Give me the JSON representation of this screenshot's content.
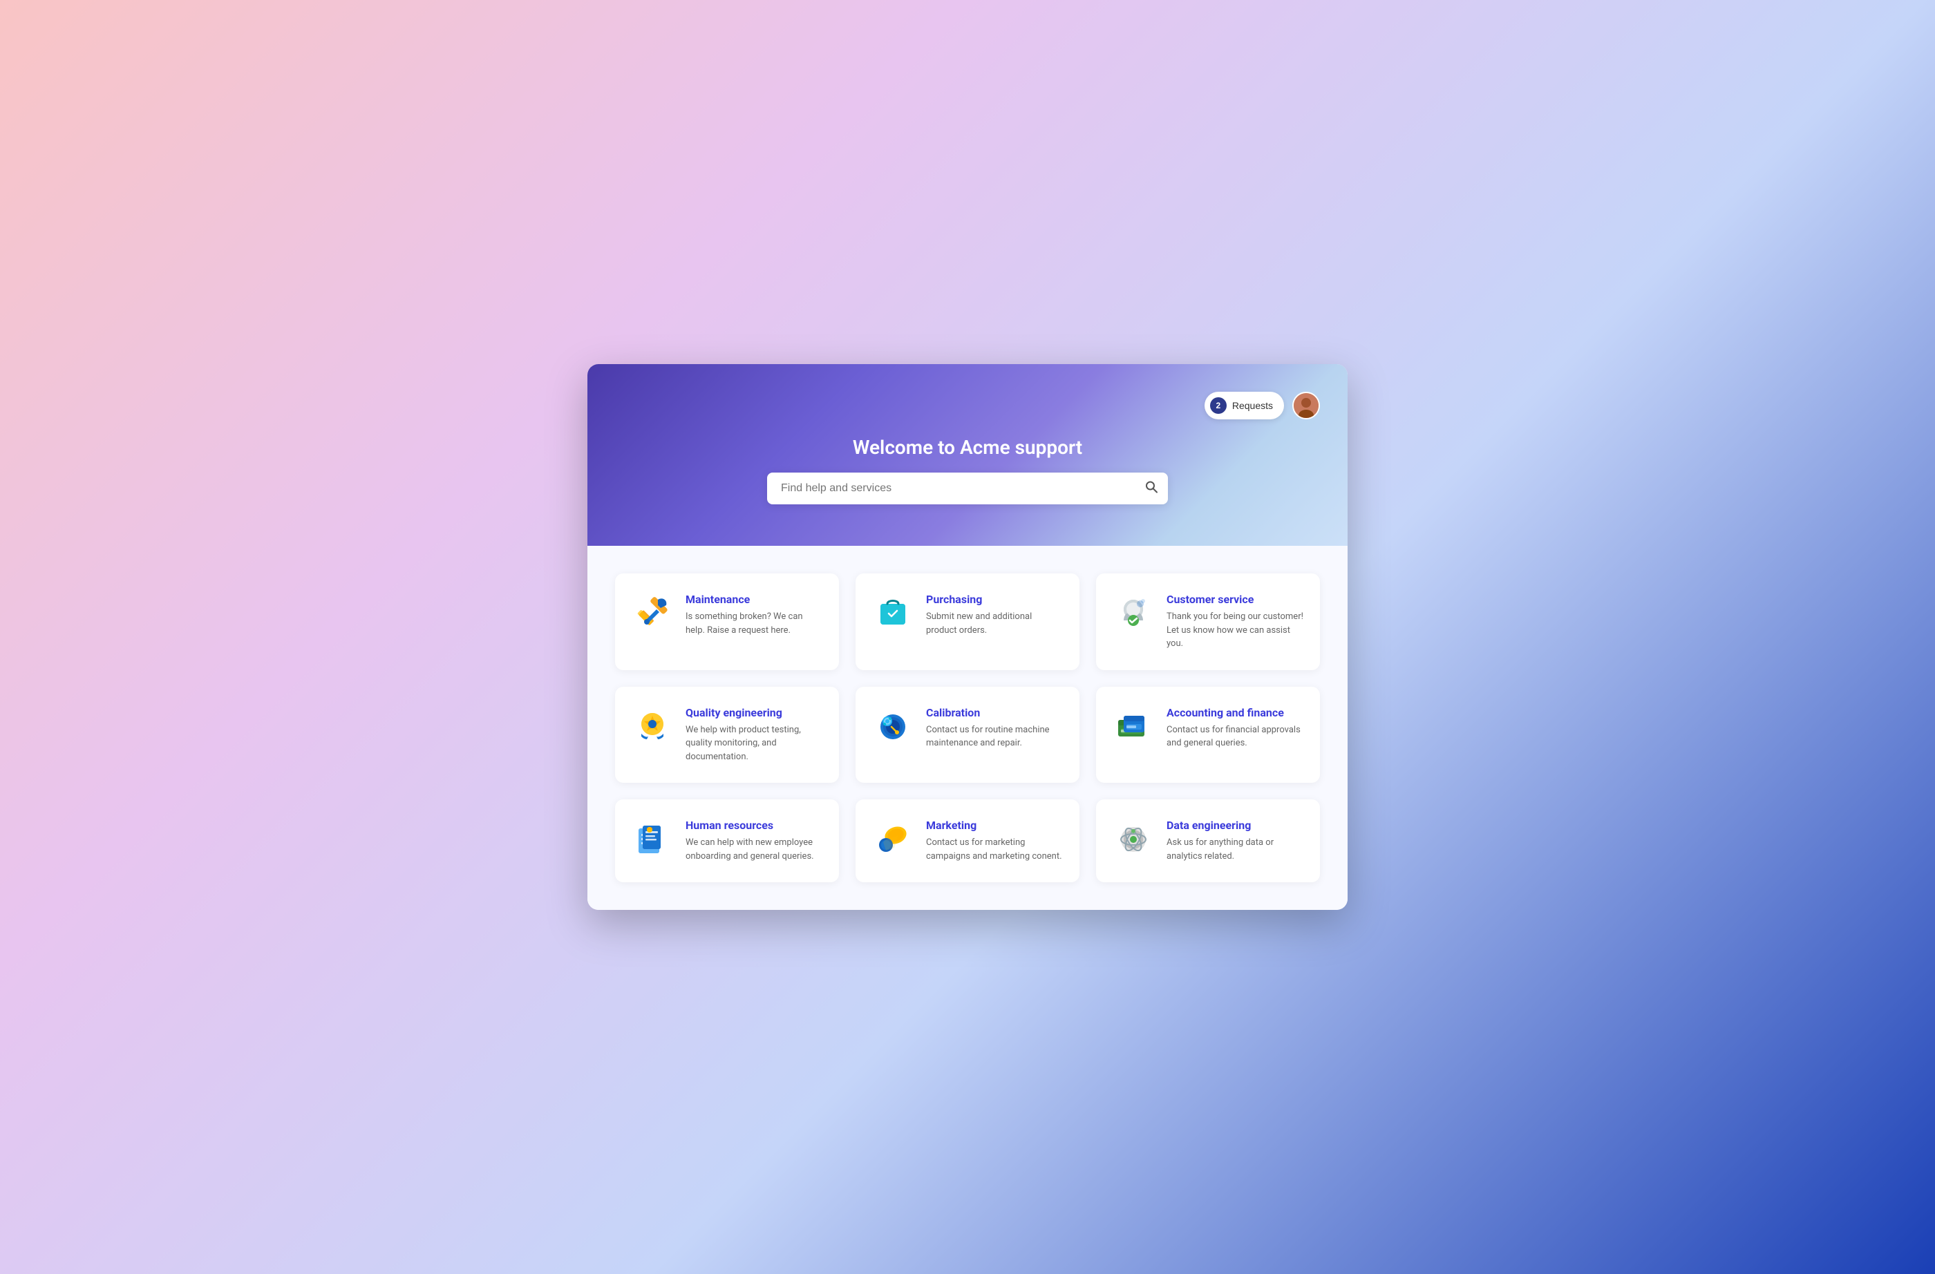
{
  "header": {
    "title": "Welcome to Acme support",
    "requests_label": "Requests",
    "requests_count": "2",
    "search_placeholder": "Find help and services"
  },
  "cards": [
    {
      "id": "maintenance",
      "title": "Maintenance",
      "description": "Is something broken? We can help. Raise a request here."
    },
    {
      "id": "purchasing",
      "title": "Purchasing",
      "description": "Submit new and additional product orders."
    },
    {
      "id": "customer-service",
      "title": "Customer service",
      "description": "Thank you for being our customer! Let us know how we can assist you."
    },
    {
      "id": "quality-engineering",
      "title": "Quality engineering",
      "description": "We help with product testing, quality monitoring, and documentation."
    },
    {
      "id": "calibration",
      "title": "Calibration",
      "description": "Contact us for routine machine maintenance and repair."
    },
    {
      "id": "accounting-finance",
      "title": "Accounting and finance",
      "description": "Contact us for financial approvals and general queries."
    },
    {
      "id": "human-resources",
      "title": "Human resources",
      "description": "We can help with new employee onboarding and general queries."
    },
    {
      "id": "marketing",
      "title": "Marketing",
      "description": "Contact us for marketing campaigns and marketing conent."
    },
    {
      "id": "data-engineering",
      "title": "Data engineering",
      "description": "Ask us for anything data or analytics related."
    }
  ]
}
